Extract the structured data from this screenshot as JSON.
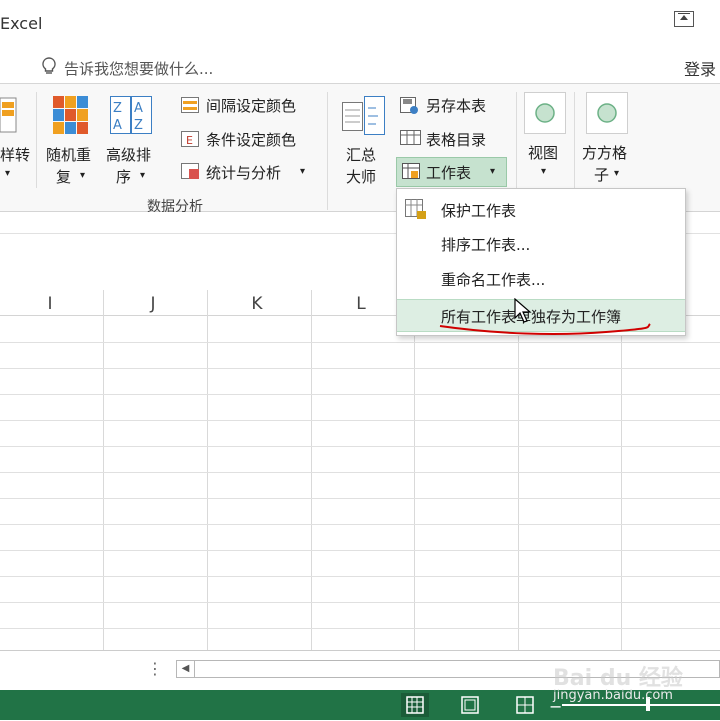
{
  "window": {
    "title": "Excel",
    "login": "登录"
  },
  "tellme": {
    "placeholder": "告诉我您想要做什么..."
  },
  "ribbon": {
    "partial_label_1": "样转",
    "random_shuffle": {
      "line1": "随机重",
      "line2": "复"
    },
    "advanced_sort": {
      "line1": "高级排",
      "line2": "序"
    },
    "interval_color": "间隔设定颜色",
    "conditional_color": "条件设定颜色",
    "stats_analysis": "统计与分析",
    "group_label": "数据分析",
    "summary_master": {
      "line1": "汇总",
      "line2": "大师"
    },
    "save_as_table": "另存本表",
    "table_directory": "表格目录",
    "worksheet": "工作表",
    "view": "视图",
    "grid": {
      "line1": "方方格",
      "line2": "子"
    }
  },
  "worksheet_menu": {
    "items": [
      {
        "label": "保护工作表"
      },
      {
        "label": "排序工作表..."
      },
      {
        "label": "重命名工作表..."
      },
      {
        "label": "所有工作表单独存为工作簿"
      }
    ],
    "highlighted_index": 3
  },
  "columns": [
    "I",
    "J",
    "K",
    "L"
  ],
  "watermark": {
    "text": "Bai du 经验",
    "url": "jingyan.baidu.com"
  },
  "colors": {
    "status_bar": "#217346",
    "menu_hover": "#ddeee3",
    "button_active": "#c6e2cf",
    "annotation": "#d00000"
  }
}
